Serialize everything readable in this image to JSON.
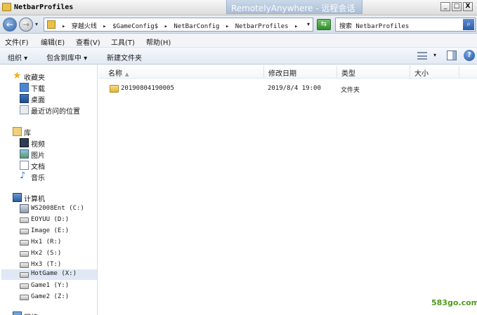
{
  "window": {
    "title": "NetbarProfiles",
    "remote_banner": "RemotelyAnywhere - 远程会话",
    "minimize": "_",
    "maximize": "□",
    "close": "X"
  },
  "address": {
    "crumbs": [
      "穿越火线",
      "$GameConfig$",
      "NetBarConfig",
      "NetbarProfiles"
    ],
    "search_placeholder": "搜索 NetbarProfiles"
  },
  "menu": [
    "文件(F)",
    "编辑(E)",
    "查看(V)",
    "工具(T)",
    "帮助(H)"
  ],
  "toolbar": {
    "organize": "组织 ▾",
    "include_in_library": "包含到库中 ▾",
    "new_folder": "新建文件夹"
  },
  "nav": {
    "favorites": {
      "label": "收藏夹",
      "items": [
        "下载",
        "桌面",
        "最近访问的位置"
      ]
    },
    "libraries": {
      "label": "库",
      "items": [
        "视频",
        "图片",
        "文档",
        "音乐"
      ]
    },
    "computer": {
      "label": "计算机",
      "drives": [
        "WS2008Ent (C:)",
        "EOYUU (D:)",
        "Image (E:)",
        "Hx1 (R:)",
        "Hx2 (S:)",
        "Hx3 (T:)",
        "HotGame (X:)",
        "Game1 (Y:)",
        "Game2 (Z:)"
      ],
      "selected": "HotGame (X:)"
    },
    "network": {
      "label": "网络"
    }
  },
  "columns": [
    "名称",
    "修改日期",
    "类型",
    "大小"
  ],
  "files": [
    {
      "name": "20190804190005",
      "modified": "2019/8/4 19:00",
      "type": "文件夹",
      "size": ""
    }
  ],
  "watermark": "583go.com"
}
